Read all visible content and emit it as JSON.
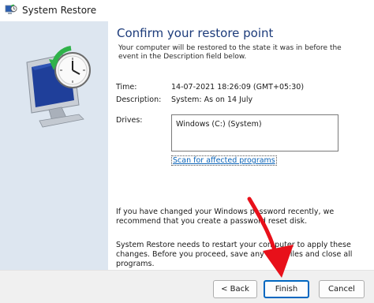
{
  "window": {
    "title": "System Restore",
    "icon": "system-restore-icon"
  },
  "main": {
    "heading": "Confirm your restore point",
    "description": "Your computer will be restored to the state it was in before the event in the Description field below.",
    "time_label": "Time:",
    "time_value": "14-07-2021 18:26:09 (GMT+05:30)",
    "description_label": "Description:",
    "description_value": "System: As on 14 July",
    "drives_label": "Drives:",
    "drives": [
      "Windows (C:) (System)"
    ],
    "scan_link": "Scan for affected programs",
    "password_note": "If you have changed your Windows password recently, we recommend that you create a password reset disk.",
    "restart_note": "System Restore needs to restart your computer to apply these changes. Before you proceed, save any open files and close all programs."
  },
  "footer": {
    "back_label": "< Back",
    "finish_label": "Finish",
    "cancel_label": "Cancel"
  },
  "colors": {
    "heading": "#1c3b7a",
    "link": "#0a63b8",
    "left_panel": "#dde6f0",
    "annotation_arrow": "#e8101a",
    "primary_border": "#0067c0"
  }
}
